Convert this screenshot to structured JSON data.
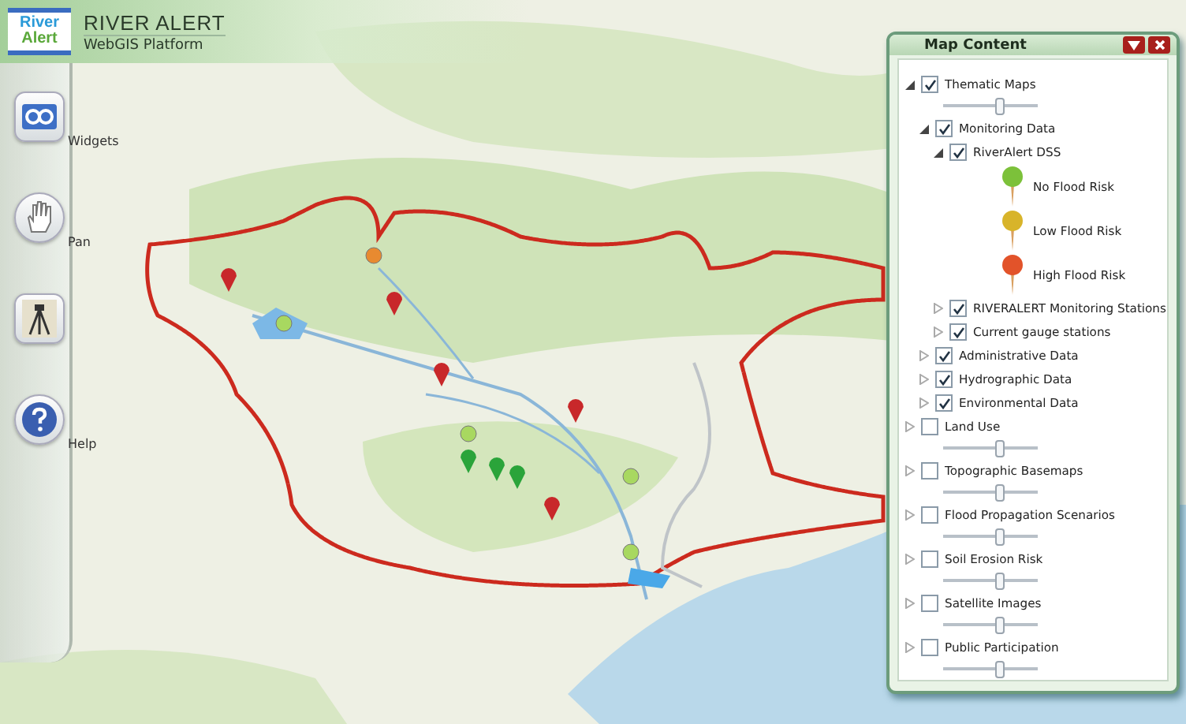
{
  "header": {
    "logo_top": "River",
    "logo_bottom": "Alert",
    "title": "RIVER ALERT",
    "subtitle": "WebGIS Platform"
  },
  "tools": [
    {
      "kind": "widgets",
      "label": "Widgets"
    },
    {
      "kind": "pan",
      "label": "Pan"
    },
    {
      "kind": "survey"
    },
    {
      "kind": "help",
      "label": "Help"
    }
  ],
  "panel": {
    "title": "Map Content",
    "layers": [
      {
        "label": "Thematic Maps",
        "checked": true,
        "expanded": true,
        "level": 0.6,
        "children": [
          {
            "label": "Monitoring Data",
            "checked": true,
            "expanded": true,
            "children": [
              {
                "label": "RiverAlert DSS",
                "checked": true,
                "expanded": true,
                "legend": [
                  {
                    "label": "No Flood Risk",
                    "color": "#7cc13a"
                  },
                  {
                    "label": "Low Flood Risk",
                    "color": "#d8b42a"
                  },
                  {
                    "label": "High Flood Risk",
                    "color": "#e2532a"
                  }
                ]
              },
              {
                "label": "RIVERALERT Monitoring Stations",
                "checked": true,
                "expanded": false
              },
              {
                "label": "Current gauge stations",
                "checked": true,
                "expanded": false
              }
            ]
          },
          {
            "label": "Administrative Data",
            "checked": true,
            "expanded": false
          },
          {
            "label": "Hydrographic Data",
            "checked": true,
            "expanded": false
          },
          {
            "label": "Environmental Data",
            "checked": true,
            "expanded": false
          }
        ]
      },
      {
        "label": "Land Use",
        "checked": false,
        "expanded": false,
        "level": 0.6
      },
      {
        "label": "Topographic Basemaps",
        "checked": false,
        "expanded": false,
        "level": 0.6
      },
      {
        "label": "Flood Propagation Scenarios",
        "checked": false,
        "expanded": false,
        "level": 0.6
      },
      {
        "label": "Soil Erosion Risk",
        "checked": false,
        "expanded": false,
        "level": 0.6
      },
      {
        "label": "Satellite Images",
        "checked": false,
        "expanded": false,
        "level": 0.6
      },
      {
        "label": "Public Participation",
        "checked": false,
        "expanded": false,
        "level": 0.6
      }
    ]
  }
}
